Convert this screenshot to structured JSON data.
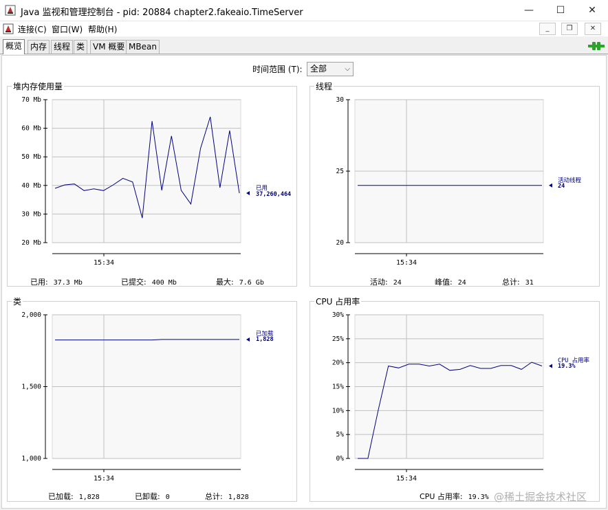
{
  "window": {
    "title": "Java 监视和管理控制台 - pid: 20884 chapter2.fakeaio.TimeServer",
    "minimize_glyph": "—",
    "maximize_glyph": "☐",
    "close_glyph": "✕"
  },
  "menu": {
    "items": [
      "连接(C)",
      "窗口(W)",
      "帮助(H)"
    ],
    "mdi_minimize": "_",
    "mdi_restore": "❐",
    "mdi_close": "✕"
  },
  "tabs": [
    "概览",
    "内存",
    "线程",
    "类",
    "VM 概要",
    "MBean"
  ],
  "time_range": {
    "label": "时间范围 (T):",
    "value": "全部"
  },
  "colors": {
    "line": "#000080",
    "grid": "#bfbfbf",
    "plot_bg": "#f8f8f8",
    "accent_green": "#2aa52a"
  },
  "panels": {
    "heap": {
      "title": "堆内存使用量",
      "series_name": "已用",
      "series_value": "37,260,464",
      "stats": [
        {
          "label": "已用:",
          "value": "37.3  Mb"
        },
        {
          "label": "已提交:",
          "value": "400  Mb"
        },
        {
          "label": "最大:",
          "value": "7.6  Gb"
        }
      ]
    },
    "threads": {
      "title": "线程",
      "series_name": "活动线程",
      "series_value": "24",
      "stats": [
        {
          "label": "活动:",
          "value": "24"
        },
        {
          "label": "峰值:",
          "value": "24"
        },
        {
          "label": "总计:",
          "value": "31"
        }
      ]
    },
    "classes": {
      "title": "类",
      "series_name": "已加载",
      "series_value": "1,828",
      "stats": [
        {
          "label": "已加载:",
          "value": "1,828"
        },
        {
          "label": "已卸载:",
          "value": "0"
        },
        {
          "label": "总计:",
          "value": "1,828"
        }
      ]
    },
    "cpu": {
      "title": "CPU 占用率",
      "series_name": "CPU 占用率",
      "series_value": "19.3%",
      "stats": [
        {
          "label": "CPU 占用率:",
          "value": "19.3%"
        }
      ]
    }
  },
  "chart_data": [
    {
      "type": "line",
      "title": "堆内存使用量",
      "ylim": [
        20,
        70
      ],
      "yticks": [
        "70 Mb",
        "60 Mb",
        "50 Mb",
        "40 Mb",
        "30 Mb",
        "20 Mb"
      ],
      "xticks": [
        "15:34"
      ],
      "series": [
        {
          "name": "已用",
          "values": [
            39,
            40.2,
            40.5,
            38.2,
            38.8,
            38.2,
            40.2,
            42.5,
            41.2,
            28.6,
            62.5,
            38.3,
            57.3,
            38.3,
            33.5,
            53,
            64,
            39.2,
            59.2,
            37.3
          ]
        }
      ]
    },
    {
      "type": "line",
      "title": "线程",
      "ylim": [
        20,
        30
      ],
      "yticks": [
        "30",
        "25",
        "20"
      ],
      "xticks": [
        "15:34"
      ],
      "series": [
        {
          "name": "活动线程",
          "values": [
            24,
            24,
            24,
            24,
            24,
            24,
            24,
            24,
            24,
            24,
            24,
            24,
            24,
            24,
            24,
            24,
            24,
            24,
            24,
            24
          ]
        }
      ]
    },
    {
      "type": "line",
      "title": "类",
      "ylim": [
        1000,
        2000
      ],
      "yticks": [
        "2,000",
        "1,500",
        "1,000"
      ],
      "xticks": [
        "15:34"
      ],
      "series": [
        {
          "name": "已加载",
          "values": [
            1825,
            1825,
            1825,
            1825,
            1825,
            1825,
            1825,
            1825,
            1825,
            1825,
            1825,
            1828,
            1828,
            1828,
            1828,
            1828,
            1828,
            1828,
            1828,
            1828
          ]
        }
      ]
    },
    {
      "type": "line",
      "title": "CPU 占用率",
      "ylim": [
        0,
        30
      ],
      "yticks": [
        "30%",
        "25%",
        "20%",
        "15%",
        "10%",
        "5%",
        "0%"
      ],
      "xticks": [
        "15:34"
      ],
      "series": [
        {
          "name": "CPU 占用率",
          "values": [
            0,
            0,
            10,
            19.3,
            18.9,
            19.7,
            19.7,
            19.3,
            19.7,
            18.4,
            18.6,
            19.4,
            18.8,
            18.8,
            19.4,
            19.4,
            18.6,
            20.1,
            19.3
          ]
        }
      ]
    }
  ],
  "watermark": "@稀土掘金技术社区"
}
